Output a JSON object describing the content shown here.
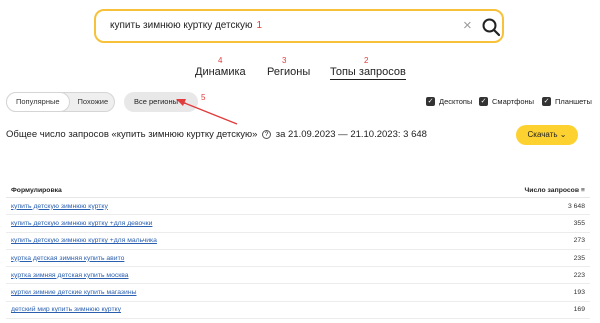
{
  "search": {
    "query": "купить зимнюю куртку детскую",
    "marker": "1",
    "clear": "×"
  },
  "tabs": [
    {
      "label": "Динамика",
      "marker": "4"
    },
    {
      "label": "Регионы",
      "marker": "3"
    },
    {
      "label": "Топы запросов",
      "marker": "2"
    }
  ],
  "filters": {
    "popular_label": "Популярные",
    "similar_label": "Похожие",
    "regions_label": "Все регионы",
    "regions_chevron": "⌄",
    "regions_marker": "5"
  },
  "devices": [
    {
      "label": "Десктопы",
      "checked": true
    },
    {
      "label": "Смартфоны",
      "checked": true
    },
    {
      "label": "Планшеты",
      "checked": true
    }
  ],
  "summary": {
    "prefix": "Общее число запросов «купить зимнюю куртку детскую»",
    "help": "?",
    "suffix": "за 21.09.2023 — 21.10.2023: 3 648"
  },
  "download": {
    "label": "Скачать",
    "chevron": "⌄"
  },
  "table": {
    "col_phrase": "Формулировка",
    "col_count": "Число запросов",
    "sort_glyph": "≡",
    "rows": [
      {
        "phrase": "купить детскую зимнюю куртку",
        "count": "3 648"
      },
      {
        "phrase": "купить детскую зимнюю куртку +для девочки",
        "count": "355"
      },
      {
        "phrase": "купить детскую зимнюю куртку +для мальчика",
        "count": "273"
      },
      {
        "phrase": "куртка детская зимняя купить авито",
        "count": "235"
      },
      {
        "phrase": "куртка зимняя детская купить москва",
        "count": "223"
      },
      {
        "phrase": "куртки зимние детские купить магазины",
        "count": "193"
      },
      {
        "phrase": "детский мир купить зимнюю куртку",
        "count": "169"
      }
    ]
  },
  "colors": {
    "accent": "#fdd130",
    "marker": "#e23b3b",
    "link": "#2a5fb0"
  }
}
